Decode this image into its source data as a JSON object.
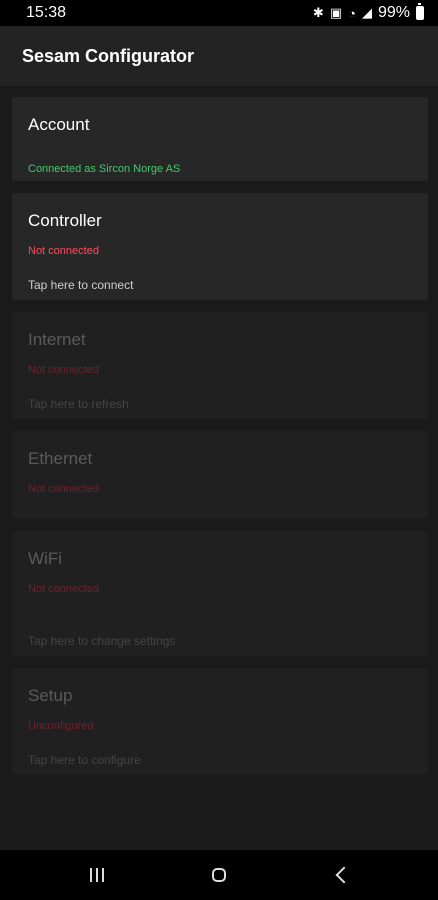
{
  "status_bar": {
    "time": "15:38",
    "icons": [
      "bluetooth-icon",
      "nfc-icon",
      "wifi-icon",
      "signal-icon"
    ],
    "battery": "99%"
  },
  "app": {
    "title": "Sesam Configurator"
  },
  "cards": {
    "account": {
      "title": "Account",
      "status": "Connected as Sircon Norge AS"
    },
    "controller": {
      "title": "Controller",
      "status": "Not connected",
      "hint": "Tap here to connect"
    },
    "internet": {
      "title": "Internet",
      "status": "Not connected",
      "hint": "Tap here to refresh"
    },
    "ethernet": {
      "title": "Ethernet",
      "status": "Not connected"
    },
    "wifi": {
      "title": "WiFi",
      "status": "Not connected",
      "hint": "Tap here to change settings"
    },
    "setup": {
      "title": "Setup",
      "status": "Unconfigured",
      "hint": "Tap here to configure"
    }
  },
  "nav": {
    "buttons": [
      "recents-icon",
      "home-icon",
      "back-icon"
    ]
  },
  "colors": {
    "connected": "#3fca6a",
    "not_connected": "#ff4a5e",
    "background": "#1a1a1a"
  }
}
